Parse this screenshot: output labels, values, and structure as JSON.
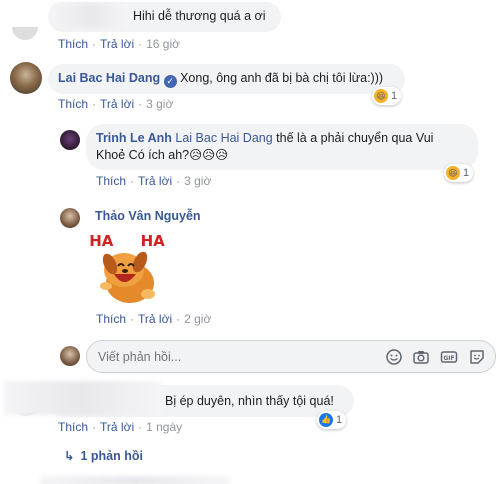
{
  "comments": [
    {
      "id": "c0",
      "author": "",
      "text": "Hihi dễ thương quá a ơi",
      "actions": {
        "like": "Thích",
        "reply": "Trả lời",
        "time": "16 giờ"
      }
    },
    {
      "id": "c1",
      "author": "Lai Bac Hai Dang",
      "verified": true,
      "text": "Xong, ông anh đã bị bà chị tôi lừa:)))",
      "reaction": {
        "icon": "haha-emoji-icon",
        "count": "1"
      },
      "actions": {
        "like": "Thích",
        "reply": "Trả lời",
        "time": "3 giờ"
      }
    },
    {
      "id": "c2",
      "author": "Trinh Le Anh",
      "mention": "Lai Bac Hai Dang",
      "text_line1": " thế là a phải chuyển qua Vui",
      "text_line2": "Khoẻ Có ích ah?😥😥😥",
      "reaction": {
        "icon": "haha-emoji-icon",
        "count": "1"
      },
      "actions": {
        "like": "Thích",
        "reply": "Trả lời",
        "time": "3 giờ"
      }
    },
    {
      "id": "c3",
      "author": "Thảo Vân Nguyễn",
      "sticker_text": "HA HA",
      "actions": {
        "like": "Thích",
        "reply": "Trả lời",
        "time": "2 giờ"
      }
    },
    {
      "id": "c4",
      "author": "",
      "text": "Bị ép duyên, nhìn thấy tội quá!",
      "reaction": {
        "icon": "like-thumb-icon",
        "count": "1"
      },
      "actions": {
        "like": "Thích",
        "reply": "Trả lời",
        "time": "1 ngày"
      }
    }
  ],
  "reply_box": {
    "placeholder": "Viết phản hồi..."
  },
  "replies_link": {
    "label": "1 phản hồi"
  },
  "colors": {
    "link": "#385898",
    "bubble": "#f2f3f5",
    "muted": "#90949c",
    "haha": "#f7b125",
    "like": "#1877f2"
  }
}
